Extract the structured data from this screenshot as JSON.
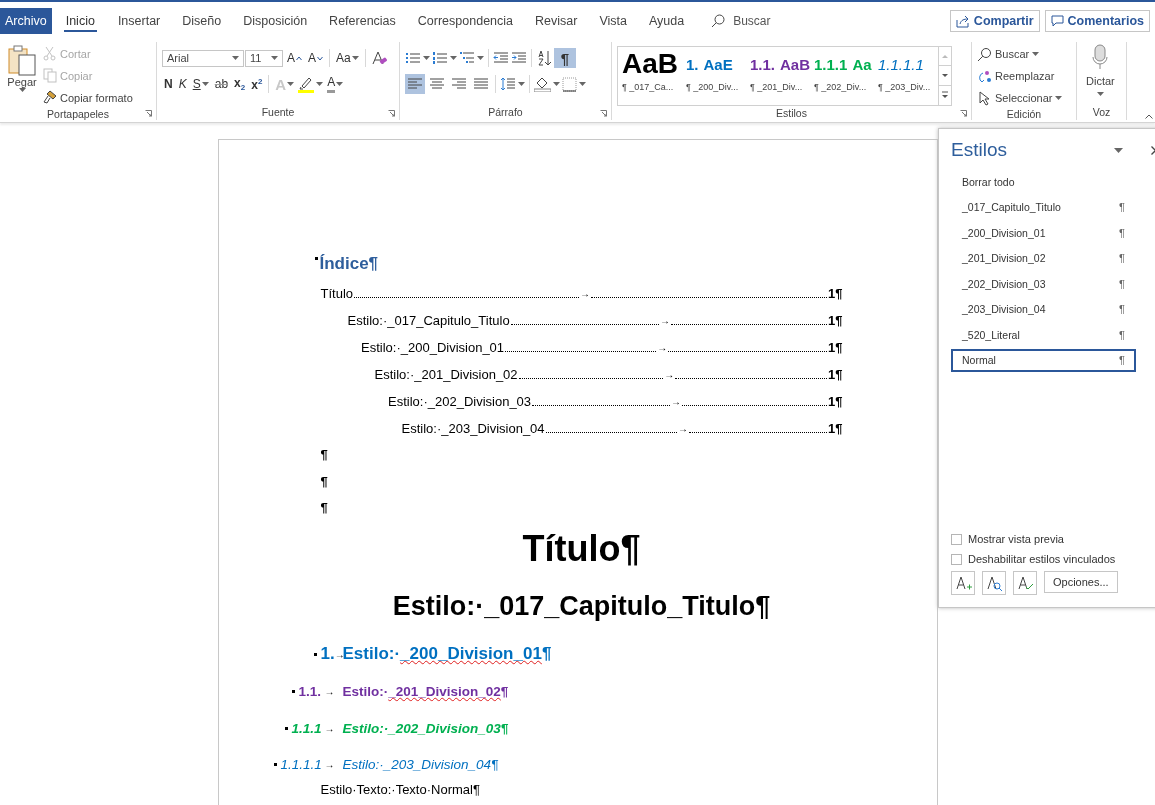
{
  "tabs": [
    {
      "label": "Archivo",
      "kind": "backstage",
      "selected": false
    },
    {
      "label": "Inicio",
      "kind": "tab",
      "selected": true
    },
    {
      "label": "Insertar",
      "kind": "tab",
      "selected": false
    },
    {
      "label": "Diseño",
      "kind": "tab",
      "selected": false
    },
    {
      "label": "Disposición",
      "kind": "tab",
      "selected": false
    },
    {
      "label": "Referencias",
      "kind": "tab",
      "selected": false
    },
    {
      "label": "Correspondencia",
      "kind": "tab",
      "selected": false
    },
    {
      "label": "Revisar",
      "kind": "tab",
      "selected": false
    },
    {
      "label": "Vista",
      "kind": "tab",
      "selected": false
    },
    {
      "label": "Ayuda",
      "kind": "tab",
      "selected": false
    }
  ],
  "search": {
    "placeholder": "Buscar"
  },
  "share_button": {
    "label": "Compartir"
  },
  "comments_button": {
    "label": "Comentarios"
  },
  "ribbon": {
    "clipboard": {
      "label": "Portapapeles",
      "paste": "Pegar",
      "actions": [
        {
          "kind": "cut",
          "label": "Cortar",
          "disabled": true
        },
        {
          "kind": "copy",
          "label": "Copiar",
          "disabled": true
        },
        {
          "kind": "format",
          "label": "Copiar formato",
          "disabled": false
        }
      ]
    },
    "font": {
      "label": "Fuente",
      "name": "Arial",
      "size": "11",
      "size_buttons": [
        {
          "kind": "grow",
          "label": "A"
        },
        {
          "kind": "shrink",
          "label": "A"
        }
      ],
      "case_button": "Aa",
      "format_buttons": [
        {
          "kind": "bold",
          "label": "N",
          "dropdown": false
        },
        {
          "kind": "italic",
          "label": "K",
          "dropdown": false
        },
        {
          "kind": "underline",
          "label": "S",
          "dropdown": true
        },
        {
          "kind": "strike",
          "label": "ab",
          "dropdown": false
        },
        {
          "kind": "sub",
          "label": "x$_{2}$",
          "dropdown": false
        },
        {
          "kind": "sup",
          "label": "x$^{2}$",
          "dropdown": false
        }
      ],
      "effect_button": "A",
      "color_button": "A"
    },
    "paragraph": {
      "label": "Párrafo",
      "show_marks": {
        "label": "¶",
        "selected": true
      },
      "alignments": [
        {
          "kind": "left",
          "selected": true
        },
        {
          "kind": "center",
          "selected": false
        },
        {
          "kind": "right",
          "selected": false
        },
        {
          "kind": "justify",
          "selected": false
        }
      ]
    },
    "styles": {
      "label": "Estilos",
      "gallery": [
        {
          "text": "AaB",
          "name": "¶ _017_Ca...",
          "color": "#000000"
        },
        {
          "number": "1.",
          "text": "AaE",
          "name": "¶ _200_Div...",
          "color": "#0070c0"
        },
        {
          "number": "1.1.",
          "text": "AaB",
          "name": "¶ _201_Div...",
          "color": "#7030a0"
        },
        {
          "number": "1.1.1",
          "text": "Aa",
          "name": "¶ _202_Div...",
          "color": "#00b050"
        },
        {
          "number": "1.1.1.1",
          "name": "¶ _203_Div...",
          "color": "#0070c0"
        }
      ]
    },
    "editing": {
      "label": "Edición",
      "actions": [
        {
          "kind": "find",
          "label": "Buscar",
          "dropdown": true
        },
        {
          "kind": "replace",
          "label": "Reemplazar",
          "dropdown": false
        },
        {
          "kind": "select",
          "label": "Seleccionar",
          "dropdown": true
        }
      ]
    },
    "voice": {
      "label": "Voz",
      "dictate": "Dictar"
    }
  },
  "document": {
    "toc_heading": {
      "text": "Índice¶",
      "keep_with_next": true
    },
    "toc": [
      {
        "text": "Título",
        "tab": "→",
        "page": "1¶",
        "children": [
          {
            "text": "Estilo:·_017_Capitulo_Titulo",
            "tab": "→",
            "page": "1¶",
            "children": [
              {
                "text": "Estilo:·_200_Division_01",
                "tab": "→",
                "page": "1¶",
                "children": [
                  {
                    "text": "Estilo:·_201_Division_02",
                    "tab": "→",
                    "page": "1¶",
                    "children": [
                      {
                        "text": "Estilo:·_202_Division_03",
                        "tab": "→",
                        "page": "1¶",
                        "children": [
                          {
                            "text": "Estilo:·_203_Division_04",
                            "tab": "→",
                            "page": "1¶"
                          }
                        ]
                      }
                    ]
                  }
                ]
              }
            ]
          }
        ]
      }
    ],
    "paragraphs": [
      {
        "kind": "empty",
        "text": "¶"
      },
      {
        "kind": "empty",
        "text": "¶"
      },
      {
        "kind": "empty",
        "text": "¶"
      },
      {
        "kind": "title",
        "text": "Título¶"
      },
      {
        "kind": "chapter",
        "text": "Estilo:·_017_Capitulo_Titulo¶"
      },
      {
        "kind": "heading1",
        "keep_with_next": true,
        "number": "1.",
        "tab": "→",
        "label": "Estilo:·",
        "term": "_200_Division_01",
        "end": "¶",
        "spelling_error": true,
        "color": "#0070c0"
      },
      {
        "kind": "heading2",
        "keep_with_next": true,
        "number": "1.1.",
        "tab": "→",
        "label": "Estilo:·",
        "term": "_201_Division_02",
        "end": "¶",
        "spelling_error": true,
        "color": "#7030a0"
      },
      {
        "kind": "heading3",
        "keep_with_next": true,
        "number": "1.1.1",
        "tab": "→",
        "label": "Estilo:·",
        "term": "_202_Division_03",
        "end": "¶",
        "spelling_error": false,
        "color": "#00b050"
      },
      {
        "kind": "heading4",
        "keep_with_next": true,
        "number": "1.1.1.1",
        "tab": "→",
        "label": "Estilo:·",
        "term": "_203_Division_04",
        "end": "¶",
        "spelling_error": false,
        "color": "#0070c0"
      },
      {
        "kind": "normal",
        "text": "Estilo·Texto:·Texto·Normal¶"
      }
    ]
  },
  "styles_pane": {
    "title": "Estilos",
    "items": [
      {
        "label": "Borrar todo",
        "selected": false
      },
      {
        "label": "_017_Capitulo_Titulo",
        "mark": "¶",
        "selected": false
      },
      {
        "label": "_200_Division_01",
        "mark": "¶",
        "selected": false
      },
      {
        "label": "_201_Division_02",
        "mark": "¶",
        "selected": false
      },
      {
        "label": "_202_Division_03",
        "mark": "¶",
        "selected": false
      },
      {
        "label": "_203_Division_04",
        "mark": "¶",
        "selected": false
      },
      {
        "label": "_520_Literal",
        "mark": "¶",
        "selected": false
      },
      {
        "label": "Normal",
        "mark": "¶",
        "selected": true
      }
    ],
    "options": [
      {
        "label": "Mostrar vista previa",
        "checked": false
      },
      {
        "label": "Deshabilitar estilos vinculados",
        "checked": false
      }
    ],
    "options_button": "Opciones..."
  }
}
